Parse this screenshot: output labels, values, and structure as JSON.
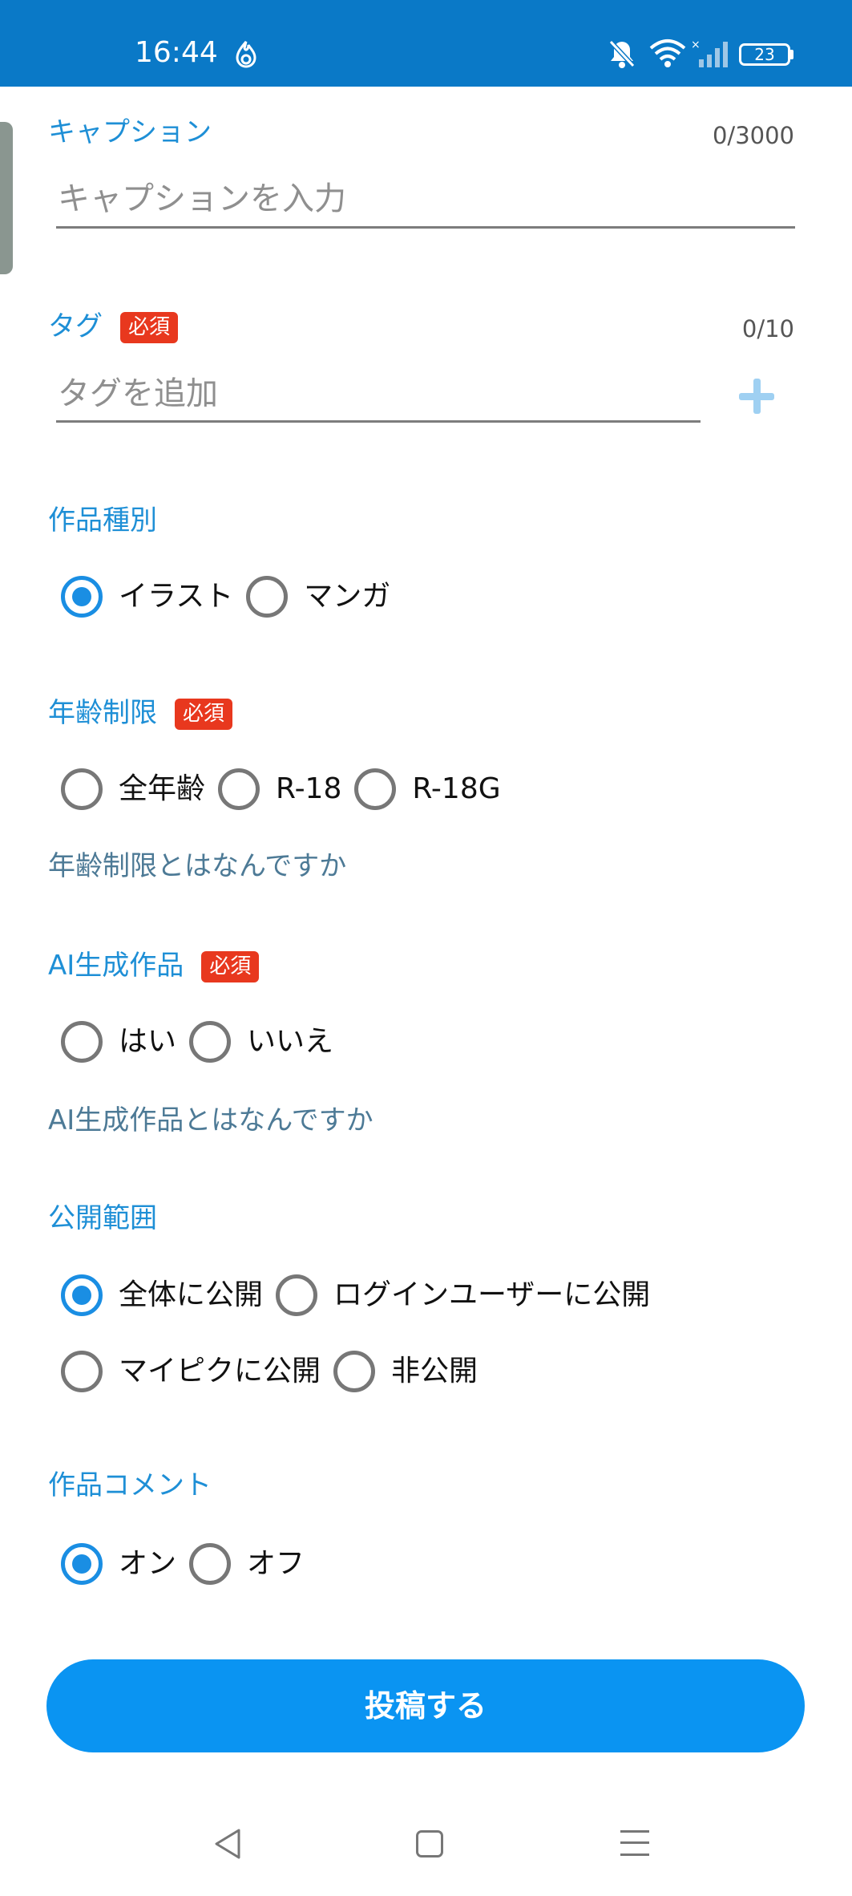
{
  "status_bar": {
    "time": "16:44",
    "battery": "23",
    "icons": [
      "flame-app-icon",
      "bell-muted-icon",
      "wifi-icon",
      "signal-icon",
      "battery-icon"
    ]
  },
  "caption": {
    "label": "キャプション",
    "counter": "0/3000",
    "placeholder": "キャプションを入力"
  },
  "tags": {
    "label": "タグ",
    "required": "必須",
    "counter": "0/10",
    "placeholder": "タグを追加",
    "add_icon": "plus-icon"
  },
  "work_type": {
    "label": "作品種別",
    "options": [
      "イラスト",
      "マンガ"
    ],
    "selected": "イラスト"
  },
  "age_limit": {
    "label": "年齢制限",
    "required": "必須",
    "options": [
      "全年齢",
      "R-18",
      "R-18G"
    ],
    "selected": null,
    "help": "年齢制限とはなんですか"
  },
  "ai_generated": {
    "label": "AI生成作品",
    "required": "必須",
    "options": [
      "はい",
      "いいえ"
    ],
    "selected": null,
    "help": "AI生成作品とはなんですか"
  },
  "visibility": {
    "label": "公開範囲",
    "options": [
      "全体に公開",
      "ログインユーザーに公開",
      "マイピクに公開",
      "非公開"
    ],
    "selected": "全体に公開"
  },
  "comments": {
    "label": "作品コメント",
    "options": [
      "オン",
      "オフ"
    ],
    "selected": "オン"
  },
  "submit": {
    "label": "投稿する"
  },
  "colors": {
    "status_bar": "#0a79c7",
    "accent": "#1a8ee3",
    "section_label": "#1e8fd6",
    "required_badge": "#e8381e",
    "submit_button": "#0a94f2"
  },
  "nav_bar": [
    "back-icon",
    "home-icon",
    "menu-icon"
  ]
}
